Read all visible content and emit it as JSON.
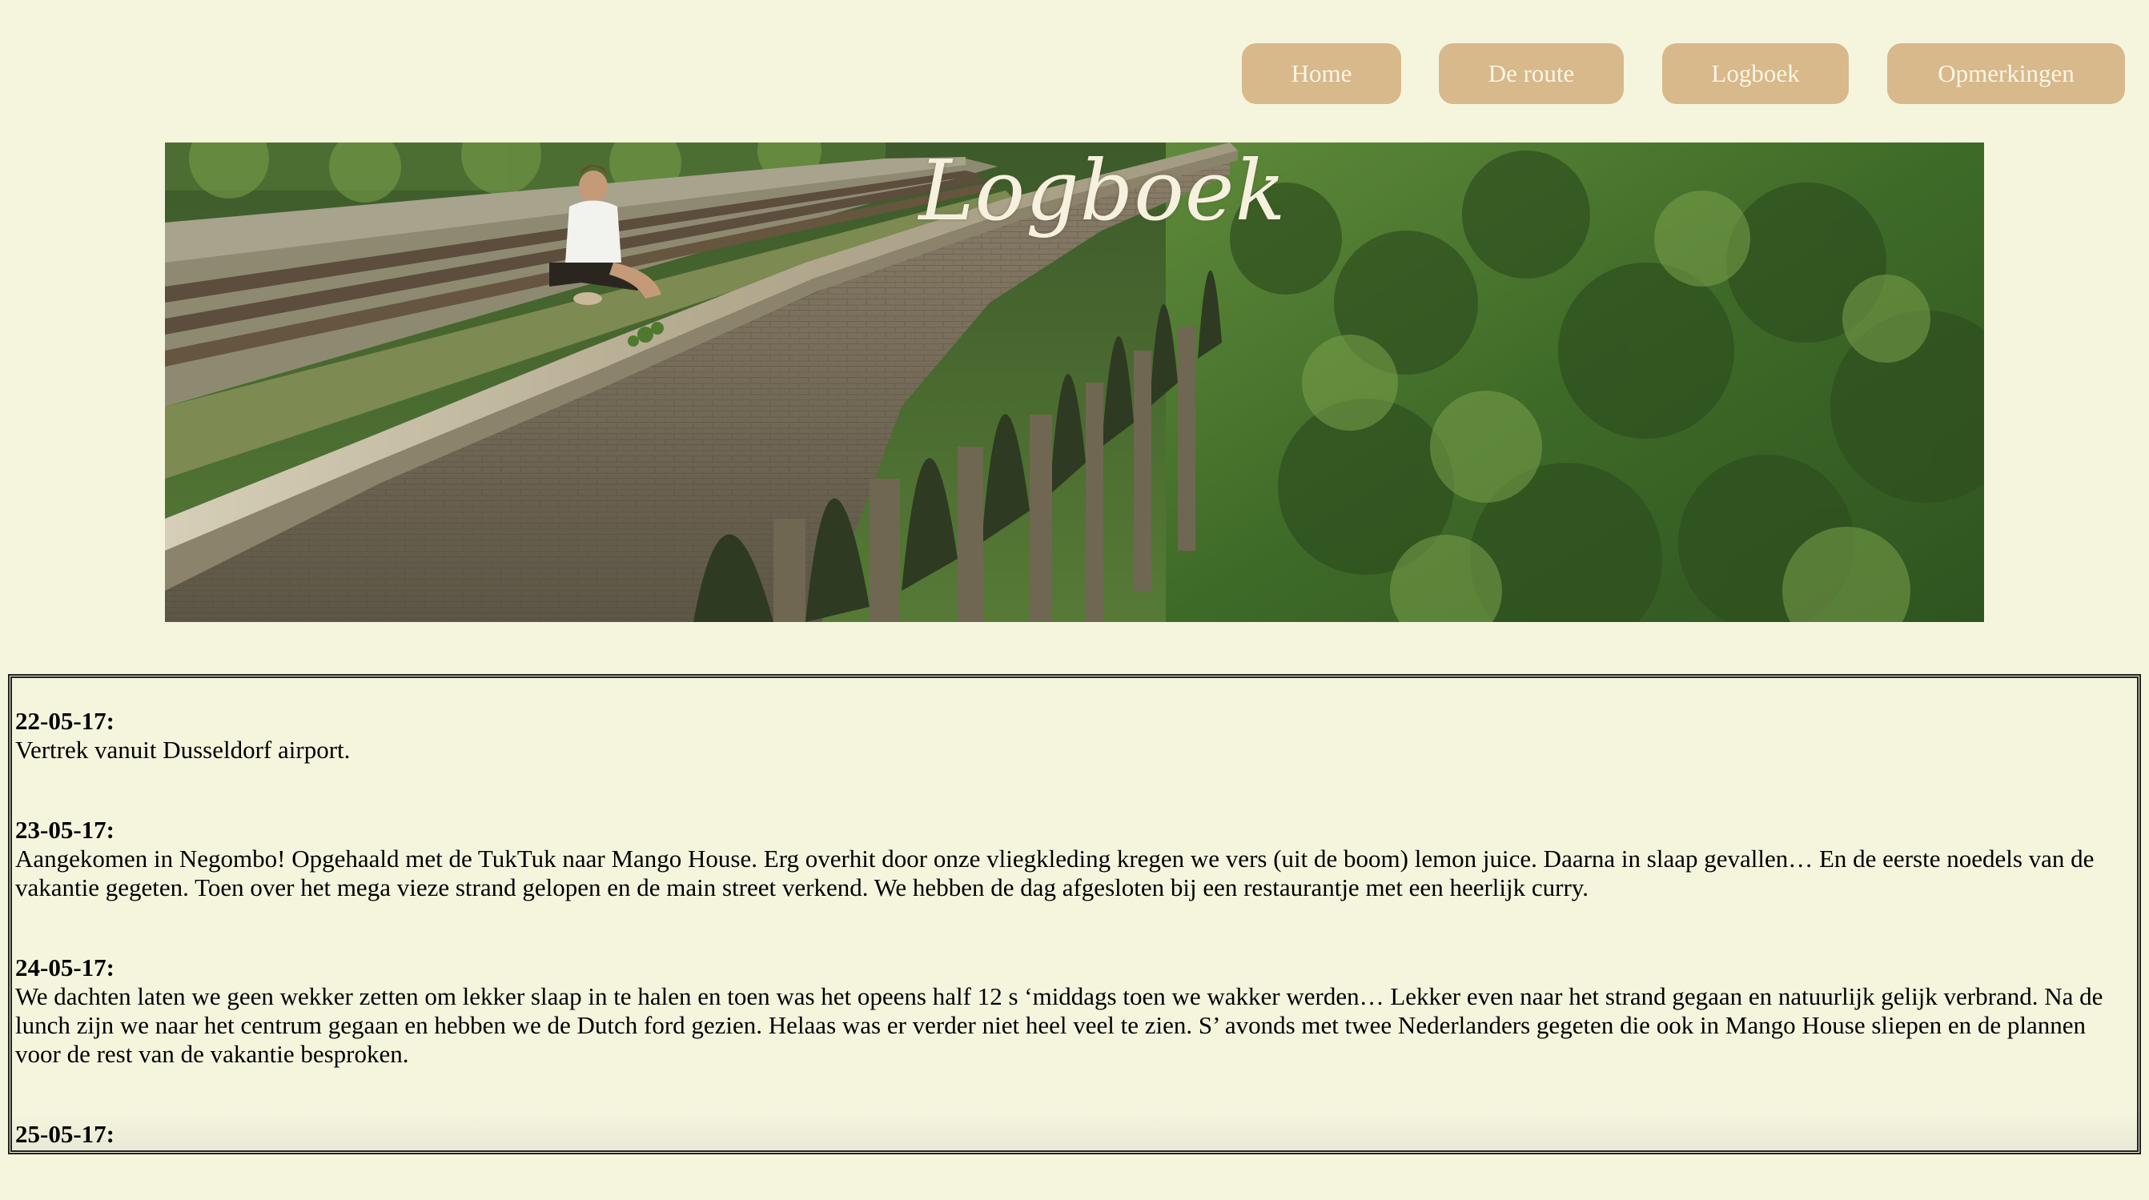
{
  "nav": {
    "items": [
      {
        "label": "Home"
      },
      {
        "label": "De route"
      },
      {
        "label": "Logboek"
      },
      {
        "label": "Opmerkingen"
      }
    ]
  },
  "banner": {
    "title": "Logboek"
  },
  "log": {
    "entries": [
      {
        "date": "22-05-17:",
        "text": "Vertrek vanuit Dusseldorf airport."
      },
      {
        "date": "23-05-17:",
        "text": "Aangekomen in Negombo! Opgehaald met de TukTuk naar Mango House. Erg overhit door onze vliegkleding kregen we vers (uit de boom) lemon juice. Daarna in slaap gevallen… En de eerste noedels van de vakantie gegeten. Toen over het mega vieze strand gelopen en de main street verkend. We hebben de dag afgesloten bij een restaurantje met een heerlijk curry."
      },
      {
        "date": "24-05-17:",
        "text": "We dachten laten we geen wekker zetten om lekker slaap in te halen en toen was het opeens half 12 s ‘middags toen we wakker werden… Lekker even naar het strand gegaan en natuurlijk gelijk verbrand. Na de lunch zijn we naar het centrum gegaan en hebben we de Dutch ford gezien. Helaas was er verder niet heel veel te zien. S’ avonds met twee Nederlanders gegeten die ook in Mango House sliepen en de plannen voor de rest van de vakantie besproken."
      },
      {
        "date": "25-05-17:",
        "text": ""
      }
    ]
  },
  "colors": {
    "background": "#f5f5de",
    "nav_button": "#d8b98b",
    "nav_text": "#fbf6e6"
  }
}
